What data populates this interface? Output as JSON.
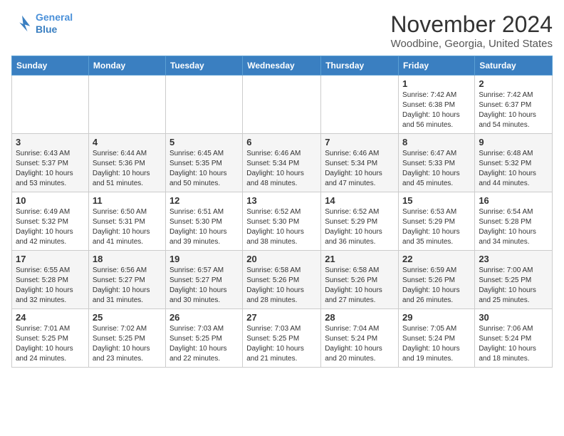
{
  "logo": {
    "line1": "General",
    "line2": "Blue"
  },
  "title": "November 2024",
  "subtitle": "Woodbine, Georgia, United States",
  "days_of_week": [
    "Sunday",
    "Monday",
    "Tuesday",
    "Wednesday",
    "Thursday",
    "Friday",
    "Saturday"
  ],
  "weeks": [
    [
      {
        "day": "",
        "info": ""
      },
      {
        "day": "",
        "info": ""
      },
      {
        "day": "",
        "info": ""
      },
      {
        "day": "",
        "info": ""
      },
      {
        "day": "",
        "info": ""
      },
      {
        "day": "1",
        "info": "Sunrise: 7:42 AM\nSunset: 6:38 PM\nDaylight: 10 hours and 56 minutes."
      },
      {
        "day": "2",
        "info": "Sunrise: 7:42 AM\nSunset: 6:37 PM\nDaylight: 10 hours and 54 minutes."
      }
    ],
    [
      {
        "day": "3",
        "info": "Sunrise: 6:43 AM\nSunset: 5:37 PM\nDaylight: 10 hours and 53 minutes."
      },
      {
        "day": "4",
        "info": "Sunrise: 6:44 AM\nSunset: 5:36 PM\nDaylight: 10 hours and 51 minutes."
      },
      {
        "day": "5",
        "info": "Sunrise: 6:45 AM\nSunset: 5:35 PM\nDaylight: 10 hours and 50 minutes."
      },
      {
        "day": "6",
        "info": "Sunrise: 6:46 AM\nSunset: 5:34 PM\nDaylight: 10 hours and 48 minutes."
      },
      {
        "day": "7",
        "info": "Sunrise: 6:46 AM\nSunset: 5:34 PM\nDaylight: 10 hours and 47 minutes."
      },
      {
        "day": "8",
        "info": "Sunrise: 6:47 AM\nSunset: 5:33 PM\nDaylight: 10 hours and 45 minutes."
      },
      {
        "day": "9",
        "info": "Sunrise: 6:48 AM\nSunset: 5:32 PM\nDaylight: 10 hours and 44 minutes."
      }
    ],
    [
      {
        "day": "10",
        "info": "Sunrise: 6:49 AM\nSunset: 5:32 PM\nDaylight: 10 hours and 42 minutes."
      },
      {
        "day": "11",
        "info": "Sunrise: 6:50 AM\nSunset: 5:31 PM\nDaylight: 10 hours and 41 minutes."
      },
      {
        "day": "12",
        "info": "Sunrise: 6:51 AM\nSunset: 5:30 PM\nDaylight: 10 hours and 39 minutes."
      },
      {
        "day": "13",
        "info": "Sunrise: 6:52 AM\nSunset: 5:30 PM\nDaylight: 10 hours and 38 minutes."
      },
      {
        "day": "14",
        "info": "Sunrise: 6:52 AM\nSunset: 5:29 PM\nDaylight: 10 hours and 36 minutes."
      },
      {
        "day": "15",
        "info": "Sunrise: 6:53 AM\nSunset: 5:29 PM\nDaylight: 10 hours and 35 minutes."
      },
      {
        "day": "16",
        "info": "Sunrise: 6:54 AM\nSunset: 5:28 PM\nDaylight: 10 hours and 34 minutes."
      }
    ],
    [
      {
        "day": "17",
        "info": "Sunrise: 6:55 AM\nSunset: 5:28 PM\nDaylight: 10 hours and 32 minutes."
      },
      {
        "day": "18",
        "info": "Sunrise: 6:56 AM\nSunset: 5:27 PM\nDaylight: 10 hours and 31 minutes."
      },
      {
        "day": "19",
        "info": "Sunrise: 6:57 AM\nSunset: 5:27 PM\nDaylight: 10 hours and 30 minutes."
      },
      {
        "day": "20",
        "info": "Sunrise: 6:58 AM\nSunset: 5:26 PM\nDaylight: 10 hours and 28 minutes."
      },
      {
        "day": "21",
        "info": "Sunrise: 6:58 AM\nSunset: 5:26 PM\nDaylight: 10 hours and 27 minutes."
      },
      {
        "day": "22",
        "info": "Sunrise: 6:59 AM\nSunset: 5:26 PM\nDaylight: 10 hours and 26 minutes."
      },
      {
        "day": "23",
        "info": "Sunrise: 7:00 AM\nSunset: 5:25 PM\nDaylight: 10 hours and 25 minutes."
      }
    ],
    [
      {
        "day": "24",
        "info": "Sunrise: 7:01 AM\nSunset: 5:25 PM\nDaylight: 10 hours and 24 minutes."
      },
      {
        "day": "25",
        "info": "Sunrise: 7:02 AM\nSunset: 5:25 PM\nDaylight: 10 hours and 23 minutes."
      },
      {
        "day": "26",
        "info": "Sunrise: 7:03 AM\nSunset: 5:25 PM\nDaylight: 10 hours and 22 minutes."
      },
      {
        "day": "27",
        "info": "Sunrise: 7:03 AM\nSunset: 5:25 PM\nDaylight: 10 hours and 21 minutes."
      },
      {
        "day": "28",
        "info": "Sunrise: 7:04 AM\nSunset: 5:24 PM\nDaylight: 10 hours and 20 minutes."
      },
      {
        "day": "29",
        "info": "Sunrise: 7:05 AM\nSunset: 5:24 PM\nDaylight: 10 hours and 19 minutes."
      },
      {
        "day": "30",
        "info": "Sunrise: 7:06 AM\nSunset: 5:24 PM\nDaylight: 10 hours and 18 minutes."
      }
    ]
  ]
}
